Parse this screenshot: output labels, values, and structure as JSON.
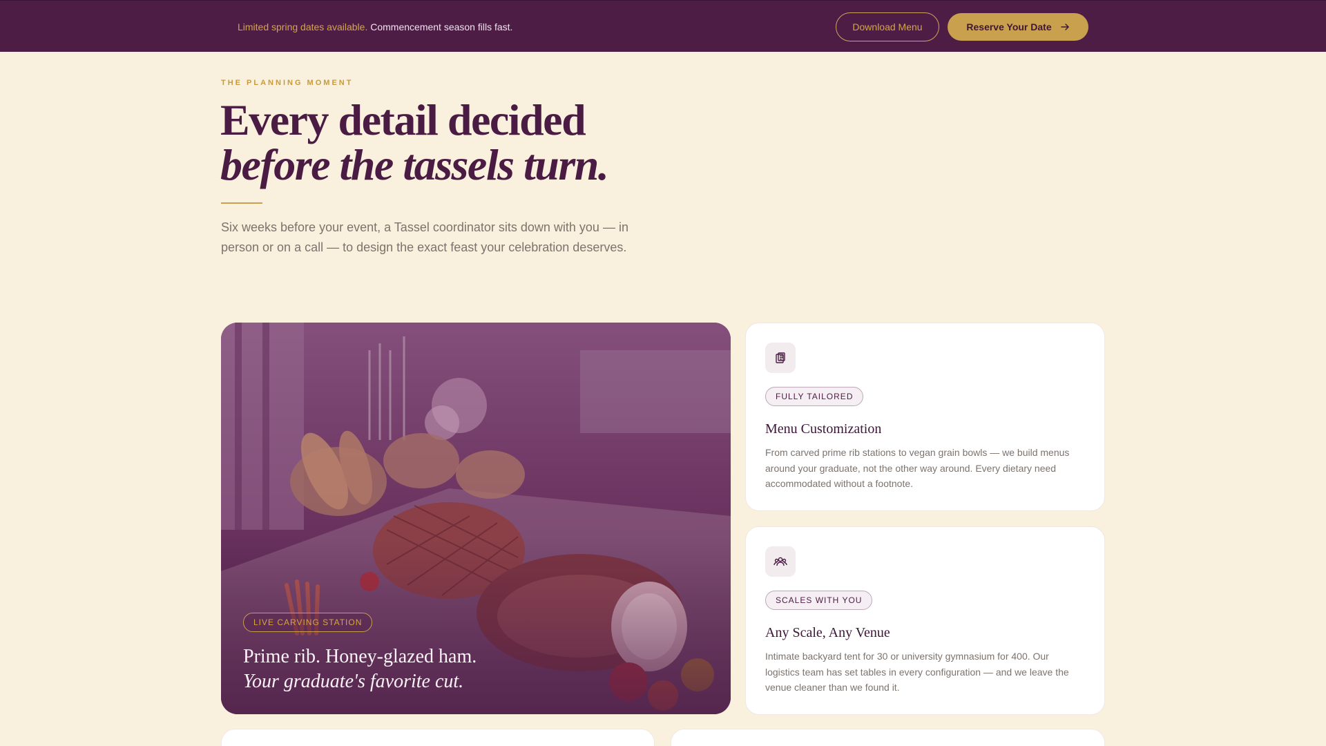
{
  "banner": {
    "accent_text": "Limited spring dates available.",
    "rest_text": "Commencement season fills fast.",
    "download_label": "Download Menu",
    "reserve_label": "Reserve Your Date"
  },
  "hero": {
    "eyebrow": "THE PLANNING MOMENT",
    "title_line1": "Every detail decided",
    "title_line2": "before the tassels turn.",
    "lead": "Six weeks before your event, a Tassel coordinator sits down with you — in person or on a call — to design the exact feast your celebration deserves."
  },
  "feature_image": {
    "badge": "LIVE CARVING STATION",
    "line1": "Prime rib. Honey-glazed ham.",
    "line2": "Your graduate's favorite cut."
  },
  "cards": [
    {
      "icon": "clipboard-icon",
      "tag": "FULLY TAILORED",
      "title": "Menu Customization",
      "body": "From carved prime rib stations to vegan grain bowls — we build menus around your graduate, not the other way around. Every dietary need accommodated without a footnote."
    },
    {
      "icon": "group-icon",
      "tag": "SCALES WITH YOU",
      "title": "Any Scale, Any Venue",
      "body": "Intimate backyard tent for 30 or university gymnasium for 400. Our logistics team has set tables in every configuration — and we leave the venue cleaner than we found it."
    }
  ],
  "colors": {
    "plum": "#4d1d46",
    "gold": "#c9a04d",
    "cream": "#f9f0dd"
  }
}
